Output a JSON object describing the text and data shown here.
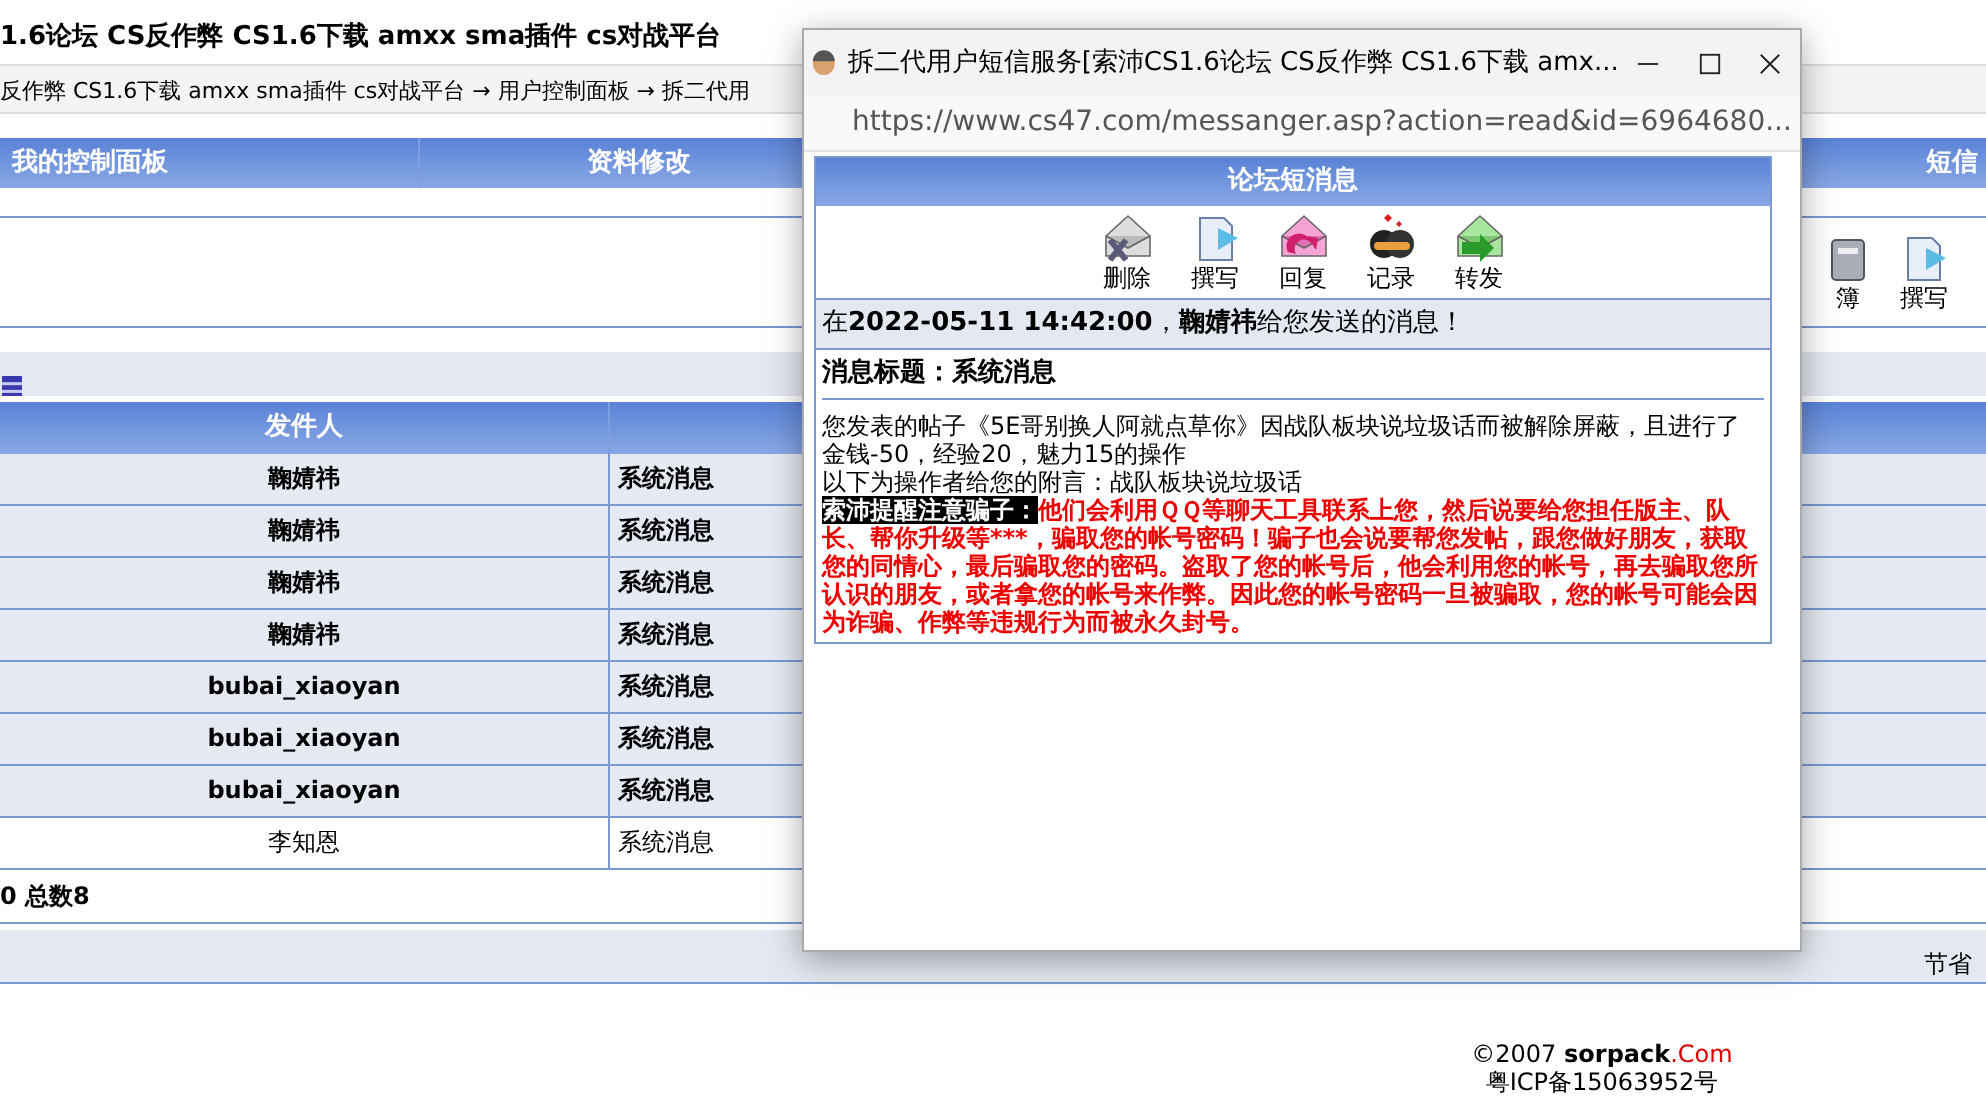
{
  "page": {
    "title": "1.6论坛 CS反作弊 CS1.6下载 amxx sma插件 cs对战平台",
    "breadcrumb": "反作弊 CS1.6下载 amxx sma插件 cs对战平台 → 用户控制面板 → 拆二代用"
  },
  "panel_tabs": [
    {
      "label": "我的控制面板"
    },
    {
      "label": "资料修改"
    },
    {
      "label": "短信"
    }
  ],
  "toolbar": [
    {
      "kind": "book",
      "label": "簿"
    },
    {
      "kind": "compose",
      "label": "撰写"
    }
  ],
  "messages": {
    "columns": [
      "发件人"
    ],
    "rows": [
      {
        "sender": "鞠婧祎",
        "subject": "系统消息",
        "unread": true
      },
      {
        "sender": "鞠婧祎",
        "subject": "系统消息",
        "unread": true
      },
      {
        "sender": "鞠婧祎",
        "subject": "系统消息",
        "unread": true
      },
      {
        "sender": "鞠婧祎",
        "subject": "系统消息",
        "unread": true
      },
      {
        "sender": "bubai_xiaoyan",
        "subject": "系统消息",
        "unread": true
      },
      {
        "sender": "bubai_xiaoyan",
        "subject": "系统消息",
        "unread": true
      },
      {
        "sender": "bubai_xiaoyan",
        "subject": "系统消息",
        "unread": true
      },
      {
        "sender": "李知恩",
        "subject": "系统消息",
        "unread": false
      }
    ]
  },
  "pager": "0 总数8",
  "footer_bar": "节省",
  "footer": {
    "copyright": "©2007",
    "site": "sorpack",
    "site_suffix": ".Com",
    "icp": "粤ICP备15063952号"
  },
  "popup": {
    "title": "拆二代用户短信服务[索沛CS1.6论坛 CS反作弊 CS1.6下载 amx...",
    "url": "https://www.cs47.com/messanger.asp?action=read&id=6964680...",
    "heading": "论坛短消息",
    "actions": [
      {
        "kind": "delete",
        "label": "删除"
      },
      {
        "kind": "compose",
        "label": "撰写"
      },
      {
        "kind": "reply",
        "label": "回复"
      },
      {
        "kind": "history",
        "label": "记录"
      },
      {
        "kind": "forward",
        "label": "转发"
      }
    ],
    "sent_line": "在**2022-05-11 14:42:00**，**鞠婧祎**给您发送的消息！",
    "subject": "消息标题：系统消息",
    "body": [
      "您发表的帖子《5E哥别换人阿就点草你》因战队板块说垃圾话而被解除屏蔽，且进行了金钱-50，经验20，魅力15的操作",
      "以下为操作者给您的附言：战队板块说垃圾话"
    ],
    "warning_label": "索沛提醒注意骗子：",
    "warning": "他们会利用ＱＱ等聊天工具联系上您，然后说要给您担任版主、队长、帮你升级等***，骗取您的帐号密码！骗子也会说要帮您发帖，跟您做好朋友，获取您的同情心，最后骗取您的密码。盗取了您的帐号后，他会利用您的帐号，再去骗取您所认识的朋友，或者拿您的帐号来作弊。因此您的帐号密码一旦被骗取，您的帐号可能会因为诈骗、作弊等违规行为而被永久封号。"
  }
}
